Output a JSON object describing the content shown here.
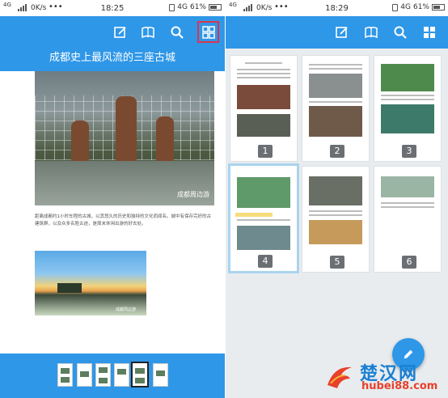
{
  "left_screen": {
    "status": {
      "signal": "4G",
      "net": "0K/s",
      "dots": "•••",
      "time": "18:25",
      "network": "4G",
      "battery": "61%"
    },
    "title": "成都史上最风流的三座古城",
    "photo1_watermark": "成都周边游",
    "paragraph": "距离成都约1小时车程的古城，以其悠久的历史和独特的文化而闻名。城中有保存完好的古建筑群，以及众多名胜古迹，是周末休闲出游的好去处。",
    "photo2_watermark": "成都周边游"
  },
  "right_screen": {
    "status": {
      "signal": "4G",
      "net": "0K/s",
      "dots": "•••",
      "time": "18:29",
      "network": "4G",
      "battery": "61%"
    },
    "pages": [
      "1",
      "2",
      "3",
      "4",
      "5",
      "6"
    ],
    "selected_page": "4"
  },
  "watermark": {
    "title": "楚汉网",
    "url": "hubei88.com"
  },
  "colors": {
    "accent": "#2f97e8",
    "highlight_border": "#d9354f",
    "selected_card": "#a9d4ef"
  }
}
